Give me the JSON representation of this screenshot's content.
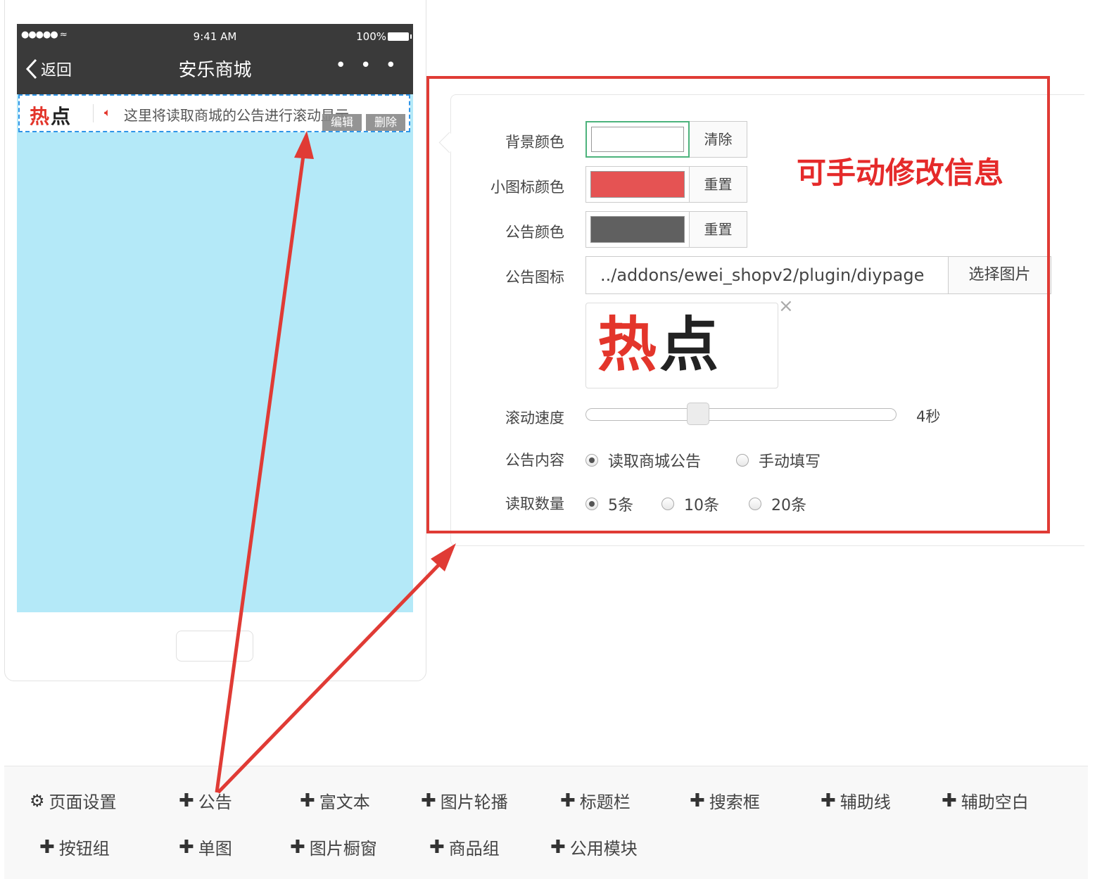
{
  "phone": {
    "signal": "●●●●● ≈",
    "time": "9:41 AM",
    "battery": "100%",
    "back_label": "返回",
    "title": "安乐商城",
    "more": "• • •",
    "notice": {
      "logo_red": "热",
      "logo_dark": "点",
      "speaker_icon": "speaker-icon",
      "text": "这里将读取商城的公告进行滚动显示",
      "edit_label": "编辑",
      "delete_label": "删除"
    },
    "screen_color": "#b4e9f8"
  },
  "editor": {
    "callout": "可手动修改信息",
    "fields": {
      "bg_color": {
        "label": "背景颜色",
        "value": "#ffffff",
        "button": "清除"
      },
      "icon_color": {
        "label": "小图标颜色",
        "value": "#e55353",
        "button": "重置"
      },
      "notice_color": {
        "label": "公告颜色",
        "value": "#606060",
        "button": "重置"
      },
      "notice_icon": {
        "label": "公告图标",
        "path": "../addons/ewei_shopv2/plugin/diypage",
        "button": "选择图片",
        "preview_red": "热",
        "preview_dark": "点",
        "remove": "×"
      },
      "speed": {
        "label": "滚动速度",
        "value_label": "4秒",
        "level": 0.35
      },
      "content": {
        "label": "公告内容",
        "options": [
          "读取商城公告",
          "手动填写"
        ],
        "selected": 0
      },
      "count": {
        "label": "读取数量",
        "options": [
          "5条",
          "10条",
          "20条"
        ],
        "selected": 0
      }
    },
    "highlight_color": "#e03b35"
  },
  "toolbar": {
    "row1": [
      "页面设置",
      "公告",
      "富文本",
      "图片轮播",
      "标题栏",
      "搜索框",
      "辅助线",
      "辅助空白"
    ],
    "row2": [
      "按钮组",
      "单图",
      "图片橱窗",
      "商品组",
      "公用模块"
    ],
    "icons": {
      "settings": "gear-icon",
      "add": "plus-icon"
    }
  }
}
